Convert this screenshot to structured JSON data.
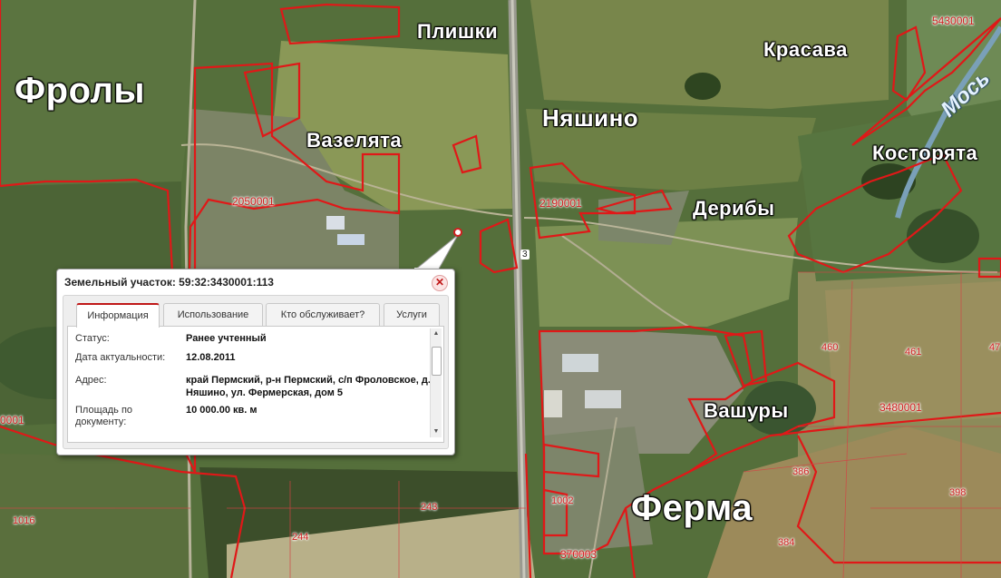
{
  "map": {
    "places": {
      "frolovy": "Фролы",
      "plishki": "Плишки",
      "krasava": "Красава",
      "vazelyata": "Вазелята",
      "nyashino": "Няшино",
      "kostoryata": "Косторята",
      "deriby": "Дерибы",
      "vashury": "Вашуры",
      "ferma": "Ферма",
      "river": "Мось"
    },
    "cadastral_labels": {
      "c1": "5430001",
      "c2": "2050001",
      "c3": "2190001",
      "c4": "3480001",
      "c5": "460",
      "c6": "461",
      "c7": "47",
      "c8": "386",
      "c9": "398",
      "c10": "384",
      "c11": "1002",
      "c12": "370003",
      "c13": "243",
      "c14": "244",
      "c15": "1016",
      "c16": "0001"
    },
    "road_number": "3",
    "colors": {
      "boundary": "#e01818",
      "satellite_base": "#4f6a38"
    }
  },
  "popup": {
    "title": "Земельный участок: 59:32:3430001:113",
    "close_icon": "close-icon",
    "tabs": [
      "Информация",
      "Использование",
      "Кто обслуживает?",
      "Услуги"
    ],
    "active_tab": "Информация",
    "fields": [
      {
        "label": "Статус:",
        "value": "Ранее учтенный"
      },
      {
        "label": "Дата актуальности:",
        "value": "12.08.2011"
      },
      {
        "label": "Адрес:",
        "value": "край Пермский, р-н Пермский, с/п Фроловское, д. Няшино, ул. Фермерская, дом 5"
      },
      {
        "label": "Площадь по документу:",
        "value": "10 000.00 кв. м"
      }
    ]
  }
}
